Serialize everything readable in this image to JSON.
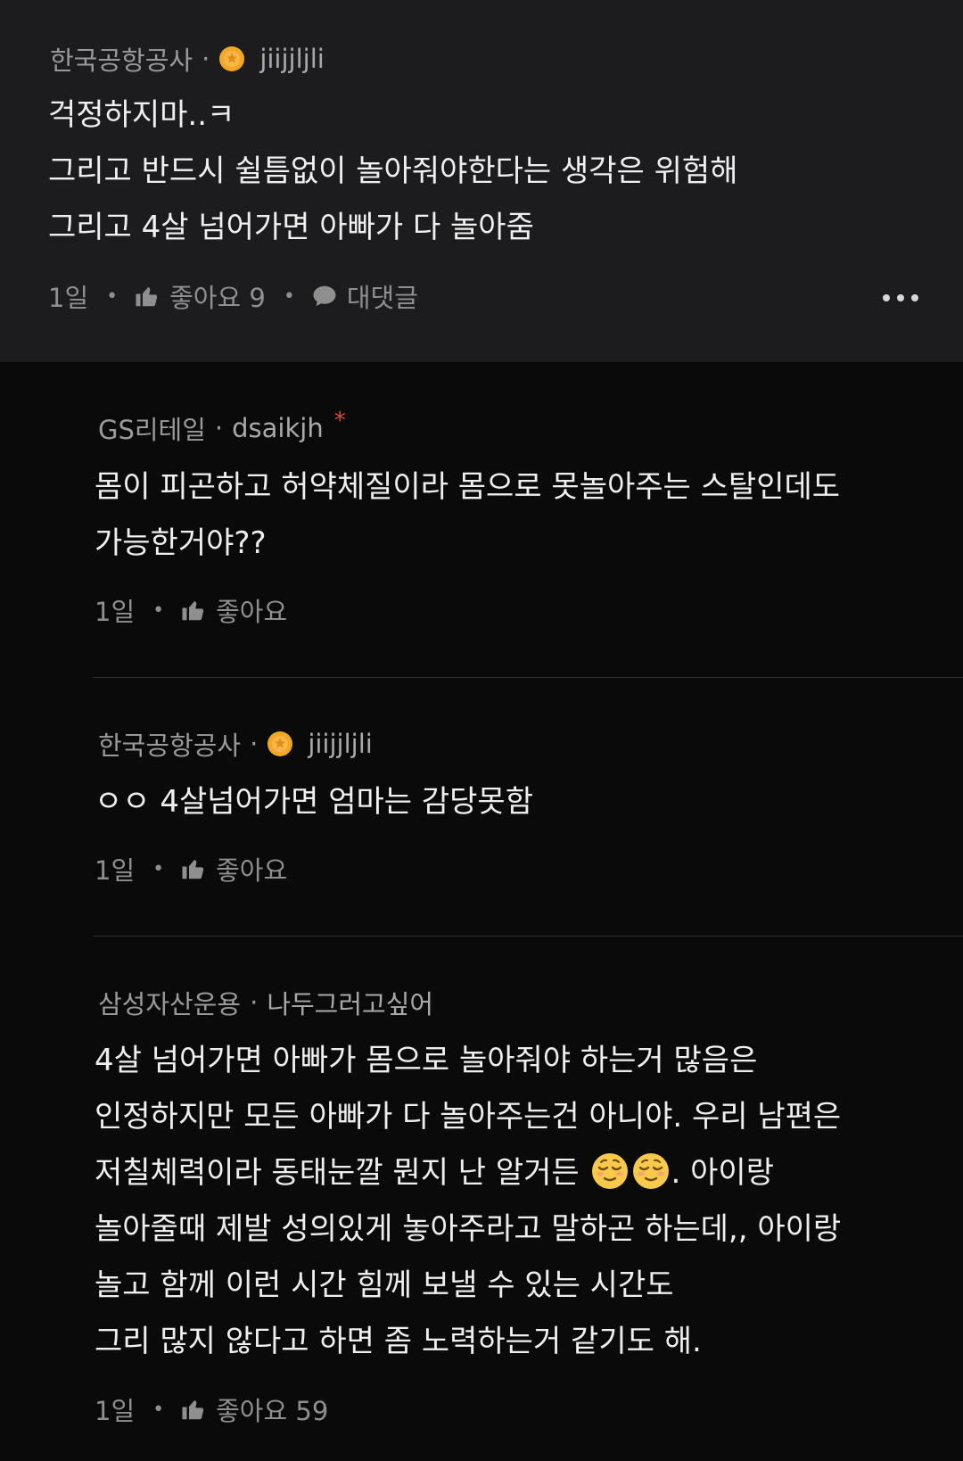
{
  "comments": [
    {
      "company": "한국공항공사",
      "nickname": "jiijjljli",
      "lines": [
        "걱정하지마..ㅋ",
        "그리고 반드시 쉴틈없이 놀아줘야한다는 생각은 위험해",
        "그리고 4살 넘어가면 아빠가 다 놀아줌"
      ],
      "time": "1일",
      "like_label": "좋아요 9",
      "reply_label": "대댓글",
      "badge_icon": "orange-medal-icon"
    },
    {
      "company": "GS리테일",
      "nickname": "dsaikjh",
      "author_marker": "*",
      "lines": [
        "몸이 피곤하고 허약체질이라 몸으로 못놀아주는 스탈인데도",
        "가능한거야??"
      ],
      "time": "1일",
      "like_label": "좋아요"
    },
    {
      "company": "한국공항공사",
      "nickname": "jiijjljli",
      "lines": [
        "ㅇㅇ 4살넘어가면 엄마는 감당못함"
      ],
      "time": "1일",
      "like_label": "좋아요",
      "badge_icon": "orange-medal-icon"
    },
    {
      "company": "삼성자산운용",
      "nickname": "나두그러고싶어",
      "lines": [
        "4살 넘어가면 아빠가 몸으로 놀아줘야 하는거 많음은",
        "인정하지만 모든 아빠가 다 놀아주는건 아니야. 우리 남편은",
        "놀아줄때 제발 성의있게 놓아주라고 말하곤 하는데,, 아이랑",
        "놀고 함께 이런 시간 힘께 보낼 수 있는 시간도",
        "그리 많지 않다고 하면 좀 노력하는거 같기도 해."
      ],
      "line3_before_emoji": "저칠체력이라 동태눈깔 뭔지 난 알거든 ",
      "line3_after_emoji": ". 아이랑",
      "emoji_icon": "relieved-face-emoji",
      "time": "1일",
      "like_label": "좋아요 59"
    }
  ],
  "colors": {
    "top_bg": "#1c1c1e",
    "page_bg": "#0a0a0a",
    "badge": "#f5a623",
    "author_marker": "#e0453a"
  },
  "icons": {
    "like": "thumbs-up-icon",
    "reply": "speech-bubble-icon",
    "more": "more-options-icon"
  }
}
